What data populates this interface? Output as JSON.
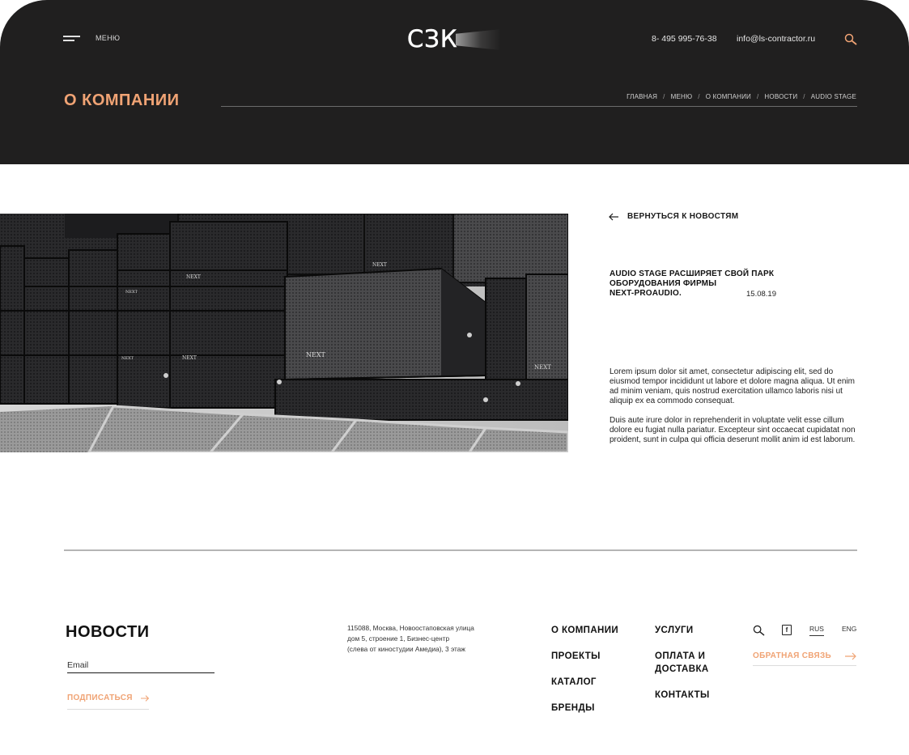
{
  "header": {
    "menu_label": "МЕНЮ",
    "logo_text": "СЗК",
    "phone": "8- 495 995-76-38",
    "email": "info@ls-contractor.ru"
  },
  "page": {
    "title": "О КОМПАНИИ",
    "breadcrumbs": [
      "ГЛАВНАЯ",
      "МЕНЮ",
      "О КОМПАНИИ",
      "НОВОСТИ",
      "AUDIO STAGE"
    ]
  },
  "article": {
    "back_label": "ВЕРНУТЬСЯ К НОВОСТЯМ",
    "title_lines": [
      "AUDIO STAGE РАСШИРЯЕТ СВОЙ ПАРК",
      "ОБОРУДОВАНИЯ ФИРМЫ",
      "NEXT-PROAUDIO."
    ],
    "date": "15.08.19",
    "paragraphs": [
      "Lorem ipsum dolor sit amet, consectetur adipiscing elit, sed do eiusmod tempor incididunt ut labore et dolore magna aliqua. Ut enim ad minim veniam, quis nostrud exercitation ullamco laboris nisi ut aliquip ex ea commodo consequat.",
      "Duis aute irure dolor in reprehenderit in voluptate velit esse cillum dolore eu fugiat nulla pariatur. Excepteur sint occaecat cupidatat non proident, sunt in culpa qui officia deserunt mollit anim id est laborum."
    ],
    "photo_label": "NEXT"
  },
  "footer": {
    "news_title": "НОВОСТИ",
    "email_placeholder": "Email",
    "subscribe_label": "ПОДПИСАТЬСЯ",
    "address_lines": [
      "115088, Москва, Новоостаповская улица",
      "дом 5, строение 1, Бизнес-центр",
      "(слева от киностудии Амедиа), 3 этаж"
    ],
    "nav_col1": [
      "О КОМПАНИИ",
      "ПРОЕКТЫ",
      "КАТАЛОГ",
      "БРЕНДЫ"
    ],
    "nav_col2": [
      "УСЛУГИ",
      "ОПЛАТА И ДОСТАВКА",
      "КОНТАКТЫ"
    ],
    "facebook_glyph": "f",
    "lang_rus": "RUS",
    "lang_eng": "ENG",
    "feedback_label": "ОБРАТНАЯ СВЯЗЬ"
  },
  "colors": {
    "accent": "#f0a374",
    "header_bg": "#201f1f"
  }
}
